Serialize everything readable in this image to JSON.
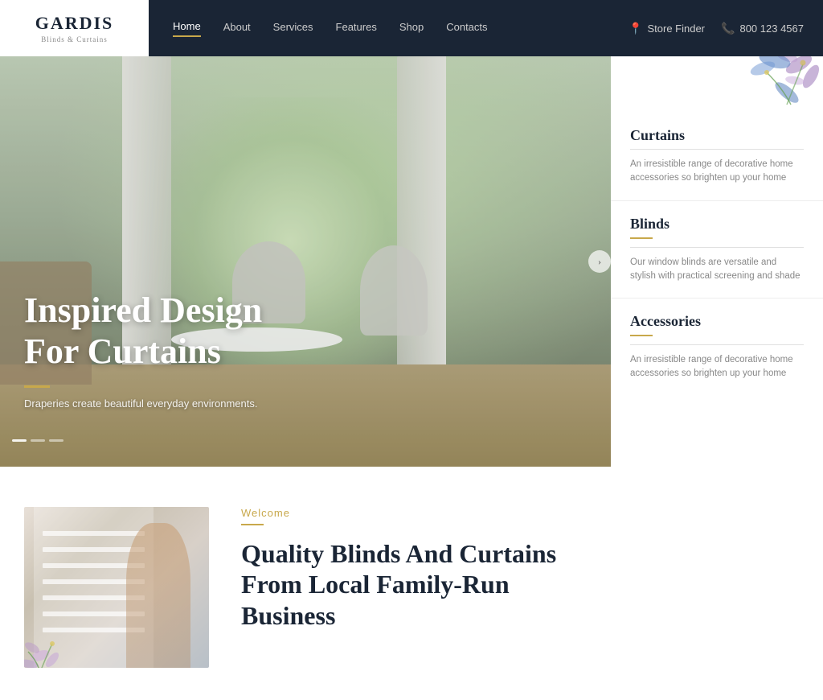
{
  "brand": {
    "name": "GARDIS",
    "subtitle": "Blinds & Curtains"
  },
  "navbar": {
    "links": [
      {
        "label": "Home",
        "active": true
      },
      {
        "label": "About",
        "active": false
      },
      {
        "label": "Services",
        "active": false
      },
      {
        "label": "Features",
        "active": false
      },
      {
        "label": "Shop",
        "active": false
      },
      {
        "label": "Contacts",
        "active": false
      }
    ],
    "store_finder": "Store Finder",
    "phone": "800 123 4567"
  },
  "hero": {
    "headline": "Inspired Design\nFor Curtains",
    "subtext": "Draperies create beautiful everyday environments.",
    "arrow_label": "›"
  },
  "sidebar": {
    "items": [
      {
        "title": "Curtains",
        "desc": "An irresistible range of decorative home accessories so brighten up your home"
      },
      {
        "title": "Blinds",
        "desc": "Our window blinds are versatile and stylish with practical screening and shade"
      },
      {
        "title": "Accessories",
        "desc": "An irresistible range of decorative home accessories so brighten up your home"
      }
    ]
  },
  "bottom": {
    "welcome_label": "Welcome",
    "headline_line1": "Quality Blinds And Curtains",
    "headline_line2": "From Local Family-Run",
    "headline_line3": "Business"
  },
  "colors": {
    "navy": "#1a2535",
    "gold": "#c8a84b",
    "text_gray": "#888888"
  }
}
